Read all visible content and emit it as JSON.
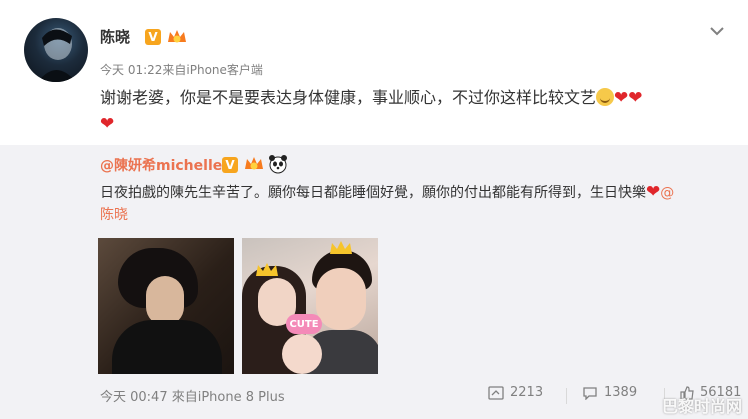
{
  "post": {
    "username": "陈晓",
    "meta": "今天 01:22来自iPhone客户端",
    "text": "谢谢老婆，你是不是要表达身体健康，事业顺心，不过你这样比较文艺"
  },
  "repost": {
    "author": "@陳妍希michelle",
    "text": "日夜拍戲的陳先生辛苦了。願你每日都能睡個好覺，願你的付出都能有所得到，生日快樂",
    "mention_at": "@",
    "mention_name": "陈晓",
    "meta": "今天 00:47 來自iPhone 8 Plus",
    "sticker_text": "CUTE",
    "actions": {
      "forward_count": "2213",
      "comment_count": "1389",
      "like_count": "56181"
    }
  },
  "icons": {
    "verified": "verified-v-icon",
    "vip": "vip-crown-icon",
    "panda": "panda-icon",
    "chevron": "chevron-down-icon",
    "forward": "forward-icon",
    "comment": "comment-icon",
    "like": "like-icon"
  },
  "colors": {
    "mention": "#eb7350",
    "badge": "#f7a51e",
    "repost_bg": "#f2f2f5",
    "heart": "#e0262b"
  },
  "watermark": "巴黎时尚网"
}
